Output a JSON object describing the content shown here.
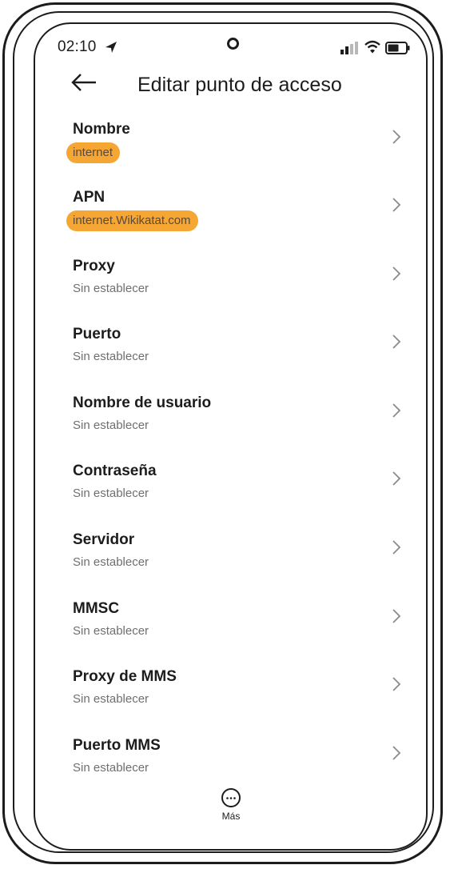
{
  "status_bar": {
    "time": "02:10"
  },
  "header": {
    "title": "Editar punto de acceso"
  },
  "items": [
    {
      "label": "Nombre",
      "value": "internet",
      "highlighted": true
    },
    {
      "label": "APN",
      "value": "internet.Wikikatat.com",
      "highlighted": true
    },
    {
      "label": "Proxy",
      "value": "Sin establecer",
      "highlighted": false
    },
    {
      "label": "Puerto",
      "value": "Sin establecer",
      "highlighted": false
    },
    {
      "label": "Nombre de usuario",
      "value": "Sin establecer",
      "highlighted": false
    },
    {
      "label": "Contraseña",
      "value": "Sin establecer",
      "highlighted": false
    },
    {
      "label": "Servidor",
      "value": "Sin establecer",
      "highlighted": false
    },
    {
      "label": "MMSC",
      "value": "Sin establecer",
      "highlighted": false
    },
    {
      "label": "Proxy de MMS",
      "value": "Sin establecer",
      "highlighted": false
    },
    {
      "label": "Puerto MMS",
      "value": "Sin establecer",
      "highlighted": false
    }
  ],
  "bottom": {
    "more_label": "Más"
  },
  "colors": {
    "highlight": "#f6a632",
    "text_primary": "#1c1c1c",
    "text_secondary": "#6f6f6f"
  },
  "icons": {
    "back": "arrow-left-icon",
    "chevron": "chevron-right-icon",
    "more": "more-horizontal-circle-icon"
  }
}
